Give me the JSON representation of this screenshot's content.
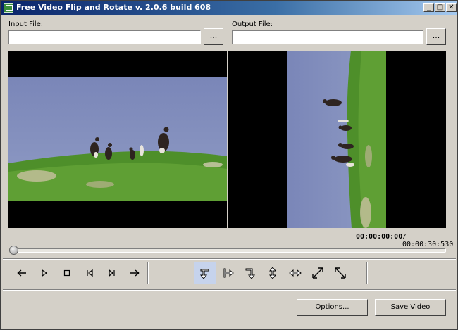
{
  "window": {
    "title": "Free Video Flip and Rotate  v. 2.0.6 build 608",
    "minimize": "_",
    "maximize": "□",
    "close": "✕"
  },
  "input_file": {
    "label": "Input File:",
    "value": "",
    "browse_label": "..."
  },
  "output_file": {
    "label": "Output File:",
    "value": "",
    "browse_label": "..."
  },
  "playback": {
    "current_time": "00:00:00:00",
    "total_time": "/ 00:00:30:530",
    "position_fraction": 0.0
  },
  "transport_icons": [
    "step-back-icon",
    "play-icon",
    "stop-icon",
    "skip-start-icon",
    "skip-end-icon",
    "step-forward-icon"
  ],
  "transform_icons": [
    "rotate-flip-down-icon",
    "rotate-right-icon",
    "rotate-down-icon",
    "flip-vertical-icon",
    "flip-horizontal-icon",
    "diagonal-ne-icon",
    "diagonal-se-icon"
  ],
  "buttons": {
    "options": "Options...",
    "save": "Save Video"
  }
}
